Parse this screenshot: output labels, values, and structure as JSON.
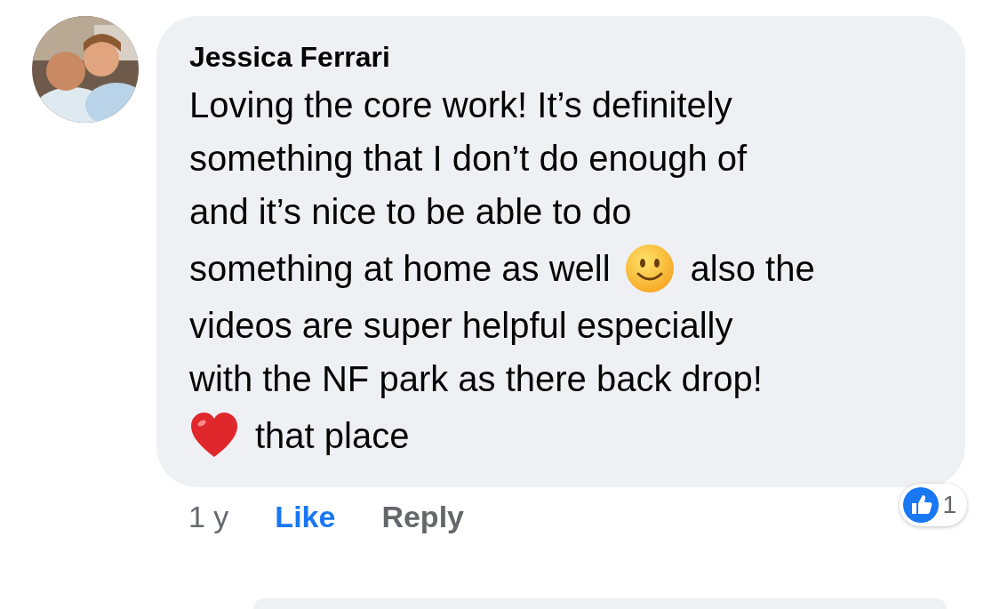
{
  "comment": {
    "author": "Jessica Ferrari",
    "paragraphs": [
      [
        {
          "kind": "text",
          "text": "Loving the core work! It’s definitely"
        }
      ],
      [
        {
          "kind": "text",
          "text": "something that I don’t do enough of"
        }
      ],
      [
        {
          "kind": "text",
          "text": "and it’s nice to be able to do"
        }
      ],
      [
        {
          "kind": "text",
          "text": "something at home as well"
        },
        {
          "kind": "smiley"
        },
        {
          "kind": "text",
          "text": "also the"
        }
      ],
      [
        {
          "kind": "text",
          "text": "videos are super helpful especially"
        }
      ],
      [
        {
          "kind": "text",
          "text": "with the NF park as there back drop!"
        }
      ],
      [
        {
          "kind": "heart"
        },
        {
          "kind": "text",
          "text": "that place"
        }
      ]
    ],
    "time": "1 y",
    "actions": [
      {
        "label": "Like",
        "selected": true
      },
      {
        "label": "Reply",
        "selected": false
      }
    ],
    "reactions": [
      {
        "kind": "like",
        "count": "1"
      }
    ]
  }
}
